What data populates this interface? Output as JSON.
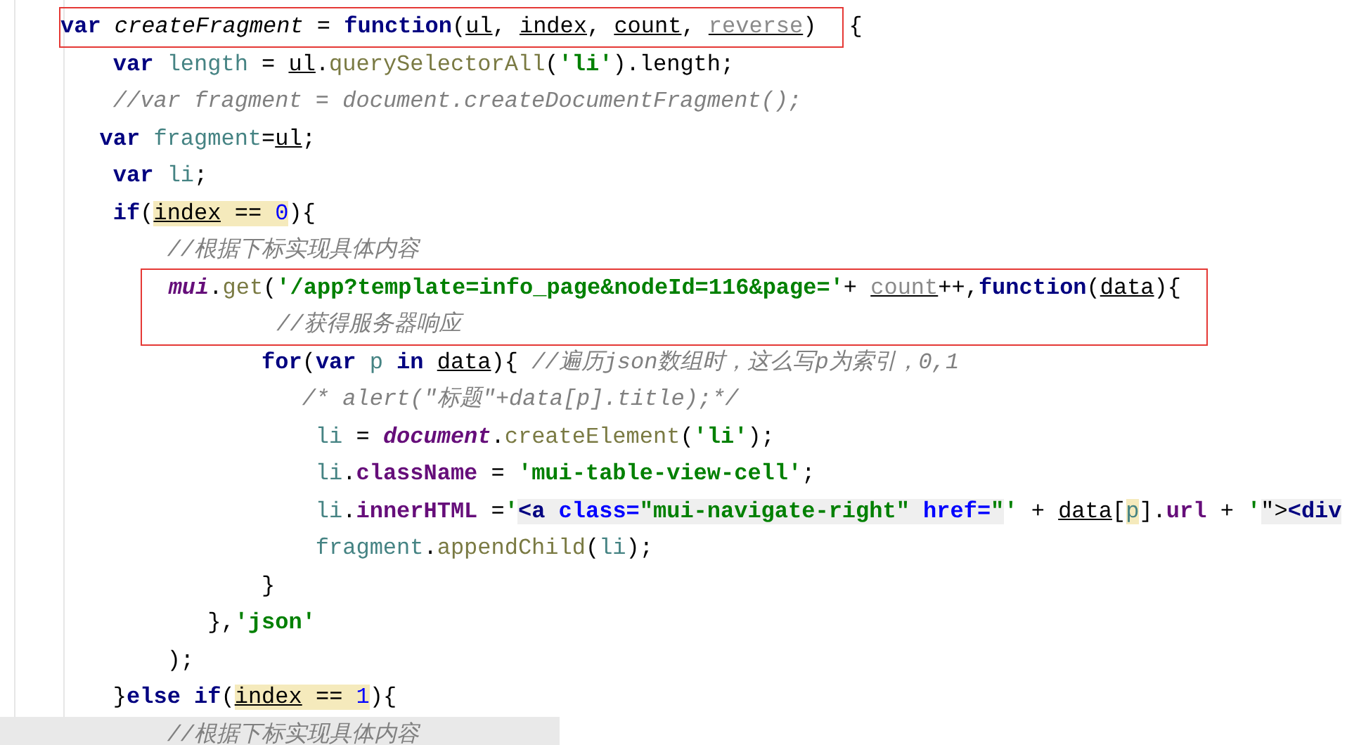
{
  "blocks": [
    {
      "boxed": true,
      "lines": [
        [
          {
            "t": "var ",
            "kind": "kw"
          },
          {
            "t": "createFragment",
            "kind": "fn"
          },
          {
            "t": " = "
          },
          {
            "t": "function",
            "kind": "kw"
          },
          {
            "t": "("
          },
          {
            "t": "ul",
            "kind": "param"
          },
          {
            "t": ", "
          },
          {
            "t": "index",
            "kind": "param"
          },
          {
            "t": ", "
          },
          {
            "t": "count",
            "kind": "param"
          },
          {
            "t": ", "
          },
          {
            "t": "reverse",
            "kind": "unused"
          },
          {
            "t": ")"
          }
        ]
      ],
      "tail": [
        {
          "t": "{"
        }
      ]
    },
    {
      "lines": [
        [
          {
            "t": "    var ",
            "kind": "kw"
          },
          {
            "t": "length",
            "kind": "local"
          },
          {
            "t": " = "
          },
          {
            "t": "ul",
            "kind": "param"
          },
          {
            "t": "."
          },
          {
            "t": "querySelectorAll",
            "kind": "method"
          },
          {
            "t": "("
          },
          {
            "t": "'li'",
            "kind": "str"
          },
          {
            "t": ").length;"
          }
        ],
        [
          {
            "t": "    //var fragment = document.createDocumentFragment();",
            "kind": "comment"
          }
        ],
        [
          {
            "t": "   var ",
            "kind": "kw"
          },
          {
            "t": "fragment",
            "kind": "local"
          },
          {
            "t": "="
          },
          {
            "t": "ul",
            "kind": "param"
          },
          {
            "t": ";"
          }
        ],
        [
          {
            "t": "    var ",
            "kind": "kw"
          },
          {
            "t": "li",
            "kind": "local"
          },
          {
            "t": ";"
          }
        ],
        [
          {
            "t": "    if",
            "kind": "kw"
          },
          {
            "t": "("
          },
          {
            "t": "index",
            "kind": "param",
            "highlighted": true
          },
          {
            "t": " == ",
            "highlighted": true
          },
          {
            "t": "0",
            "kind": "num",
            "highlighted": true
          },
          {
            "t": "){"
          }
        ],
        [
          {
            "t": "        //根据下标实现具体内容",
            "kind": "comment"
          }
        ]
      ]
    },
    {
      "boxed": true,
      "lines": [
        [
          {
            "t": "        mui",
            "kind": "global"
          },
          {
            "t": "."
          },
          {
            "t": "get",
            "kind": "method"
          },
          {
            "t": "("
          },
          {
            "t": "'/app?template=info_page&nodeId=116&page='",
            "kind": "str"
          },
          {
            "t": "+ "
          },
          {
            "t": "count",
            "kind": "unused"
          },
          {
            "t": "++,"
          },
          {
            "t": "function",
            "kind": "kw"
          },
          {
            "t": "("
          },
          {
            "t": "data",
            "kind": "param"
          },
          {
            "t": "){"
          }
        ],
        [
          {
            "t": "                //获得服务器响应",
            "kind": "comment"
          }
        ]
      ]
    },
    {
      "lines": [
        [
          {
            "t": "               for",
            "kind": "kw"
          },
          {
            "t": "("
          },
          {
            "t": "var ",
            "kind": "kw"
          },
          {
            "t": "p ",
            "kind": "local"
          },
          {
            "t": "in ",
            "kind": "kw"
          },
          {
            "t": "data",
            "kind": "param"
          },
          {
            "t": "){ "
          },
          {
            "t": "//遍历json数组时，这么写p为索引，0,1",
            "kind": "comment"
          }
        ],
        [
          {
            "t": "                  /* alert(\"标题\"+data[p].title);*/",
            "kind": "comment"
          }
        ],
        [
          {
            "t": "                   li",
            "kind": "local"
          },
          {
            "t": " = "
          },
          {
            "t": "document",
            "kind": "global"
          },
          {
            "t": "."
          },
          {
            "t": "createElement",
            "kind": "method"
          },
          {
            "t": "("
          },
          {
            "t": "'li'",
            "kind": "str"
          },
          {
            "t": ");"
          }
        ],
        [
          {
            "t": "                   li",
            "kind": "local"
          },
          {
            "t": "."
          },
          {
            "t": "className",
            "kind": "prop"
          },
          {
            "t": " = "
          },
          {
            "t": "'mui-table-view-cell'",
            "kind": "str"
          },
          {
            "t": ";"
          }
        ],
        [
          {
            "t": "                   li",
            "kind": "local"
          },
          {
            "t": "."
          },
          {
            "t": "innerHTML",
            "kind": "prop"
          },
          {
            "t": " ="
          },
          {
            "t": "'",
            "kind": "str"
          },
          {
            "t": "<a ",
            "kind": "tag",
            "shaded": true
          },
          {
            "t": "class=",
            "kind": "attr",
            "shaded": true
          },
          {
            "t": "\"mui-navigate-right\" ",
            "kind": "str",
            "shaded": true
          },
          {
            "t": "href=",
            "kind": "attr",
            "shaded": true
          },
          {
            "t": "\"",
            "kind": "str",
            "shaded": true
          },
          {
            "t": "'",
            "kind": "str"
          },
          {
            "t": " + "
          },
          {
            "t": "data",
            "kind": "param"
          },
          {
            "t": "["
          },
          {
            "t": "p",
            "kind": "local",
            "highlighted": true
          },
          {
            "t": "]."
          },
          {
            "t": "url",
            "kind": "prop"
          },
          {
            "t": " + "
          },
          {
            "t": "'",
            "kind": "str"
          },
          {
            "t": "\">",
            "shaded": true
          },
          {
            "t": "<div",
            "kind": "tag",
            "shaded": true
          }
        ],
        [
          {
            "t": "                   fragment",
            "kind": "local"
          },
          {
            "t": "."
          },
          {
            "t": "appendChild",
            "kind": "method"
          },
          {
            "t": "("
          },
          {
            "t": "li",
            "kind": "local"
          },
          {
            "t": ");"
          }
        ],
        [
          {
            "t": "               }"
          }
        ],
        [
          {
            "t": "           },"
          },
          {
            "t": "'json'",
            "kind": "str"
          }
        ],
        [
          {
            "t": "        );"
          }
        ],
        [
          {
            "t": "    }"
          },
          {
            "t": "else if",
            "kind": "kw"
          },
          {
            "t": "("
          },
          {
            "t": "index",
            "kind": "param",
            "highlighted": true
          },
          {
            "t": " == ",
            "highlighted": true
          },
          {
            "t": "1",
            "kind": "num",
            "highlighted": true
          },
          {
            "t": "){"
          }
        ]
      ]
    },
    {
      "band": true,
      "lines": [
        [
          {
            "t": "        //根据下标实现具体内容",
            "kind": "comment"
          }
        ]
      ]
    }
  ]
}
